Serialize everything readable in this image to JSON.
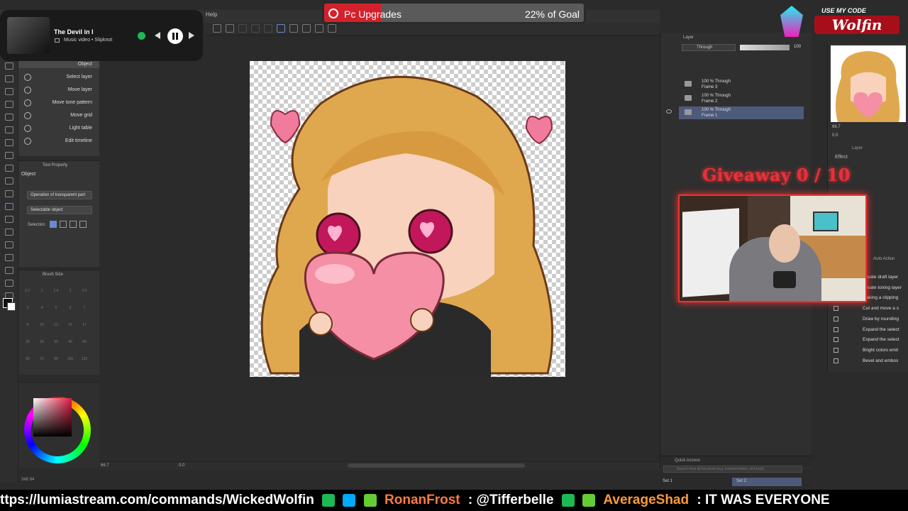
{
  "menu": {
    "help": "Help"
  },
  "music_widget": {
    "title": "The Devil in I",
    "subtitle": "Music video • Slipknot"
  },
  "goal": {
    "title": "Pc Upgrades",
    "progress_text": "22% of Goal",
    "progress": 0.22
  },
  "code_banner": {
    "top_text": "USE MY CODE",
    "name": "Wolfin"
  },
  "subtool": {
    "header": "Object",
    "items": [
      "Object",
      "Select layer",
      "Move layer",
      "Move tone pattern",
      "Move grid",
      "Light table",
      "Edit timeline"
    ]
  },
  "tool_property": {
    "panel_title": "Tool Property",
    "name": "Object",
    "operation": "Operation of transparent part",
    "selectable": "Selectable object",
    "selection_label": "Selection"
  },
  "brush_size": {
    "panel_title": "Brush Size",
    "sizes": [
      "0.7",
      "1",
      "1.5",
      "2",
      "2.5",
      "3",
      "4",
      "5",
      "6",
      "7",
      "8",
      "10",
      "12",
      "15",
      "17",
      "20",
      "25",
      "30",
      "40",
      "50",
      "60",
      "70",
      "80",
      "100",
      "120"
    ]
  },
  "canvas_status": {
    "zoom": "66.7",
    "angle": "0.0",
    "coords": "348 94",
    "extra": "0"
  },
  "layers": {
    "panel_title": "Layer",
    "blend_mode": "Through",
    "opacity": "100",
    "items": [
      {
        "line1": "100 % Through",
        "line2": "Frame 3"
      },
      {
        "line1": "100 % Through",
        "line2": "Frame 2"
      },
      {
        "line1": "100 % Through",
        "line2": "Frame 1"
      }
    ],
    "quick_access": "Quick Access",
    "search_placeholder": "Search from all functions (e.g. transformation, oil brush)"
  },
  "sets": {
    "set1": "Set 1",
    "set2": "Set 2"
  },
  "navigator": {
    "zoom": "66.7",
    "angle": "0.0"
  },
  "right_panel": {
    "layer_tab": "Layer",
    "effect": "Effect"
  },
  "giveaway": {
    "text": "Giveaway 0 / 10"
  },
  "auto_action": {
    "title": "Auto Action",
    "items": [
      "Create draft layer",
      "Create toning layer",
      "Making a clipping",
      "Cut and move a s",
      "Draw by rounding",
      "Expand the select",
      "Expand the select",
      "Bright colors emit",
      "Bevel and embos"
    ]
  },
  "ticker": {
    "url": "ttps://lumiastream.com/commands/WickedWolfin",
    "user1": "RonanFrost",
    "user1_msg": ": @Tifferbelle",
    "user2": "AverageShad",
    "user2_msg": ": IT WAS EVERYONE"
  },
  "colors": {
    "accent_red": "#d3212c",
    "layer_sel": "#4d5a7a",
    "current_color": "#e11a43"
  }
}
